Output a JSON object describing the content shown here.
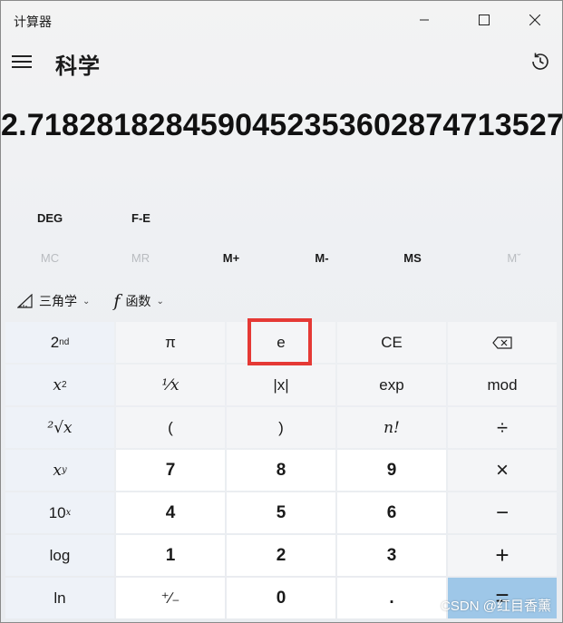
{
  "window": {
    "title": "计算器"
  },
  "header": {
    "mode_title": "科学",
    "menu_icon": "hamburger-menu-icon",
    "history_icon": "history-icon"
  },
  "display": {
    "value": "2.7182818284590452353602874713527"
  },
  "modes": {
    "angle": "DEG",
    "notation": "F-E"
  },
  "memory": [
    {
      "label": "MC",
      "enabled": false
    },
    {
      "label": "MR",
      "enabled": false
    },
    {
      "label": "M+",
      "enabled": true
    },
    {
      "label": "M-",
      "enabled": true
    },
    {
      "label": "MS",
      "enabled": true
    },
    {
      "label": "Mˇ",
      "enabled": false
    }
  ],
  "functions": {
    "trig": "三角学",
    "func": "函数",
    "trig_icon": "triangle-ruler-icon",
    "func_icon": "italic-f-icon"
  },
  "keys": {
    "second": "2",
    "second_sup": "nd",
    "pi": "π",
    "e": "e",
    "ce": "CE",
    "backspace_icon": "backspace-icon",
    "x_sq": "x",
    "x_sq_sup": "2",
    "reciprocal": "¹⁄x",
    "abs": "|x|",
    "exp": "exp",
    "mod": "mod",
    "sqrt": "²√x",
    "lparen": "(",
    "rparen": ")",
    "factorial": "n!",
    "divide": "÷",
    "x_pow_y": "x",
    "x_pow_y_sup": "y",
    "seven": "7",
    "eight": "8",
    "nine": "9",
    "multiply": "×",
    "ten_pow": "10",
    "ten_pow_sup": "x",
    "four": "4",
    "five": "5",
    "six": "6",
    "minus": "−",
    "log": "log",
    "one": "1",
    "two": "2",
    "three": "3",
    "plus": "+",
    "ln": "ln",
    "negate": "⁺∕₋",
    "zero": "0",
    "decimal": ".",
    "equals": "="
  },
  "watermark": "CSDN @红目香薰",
  "colors": {
    "equals_bg": "#9ec7e8",
    "highlight": "#e53935"
  }
}
